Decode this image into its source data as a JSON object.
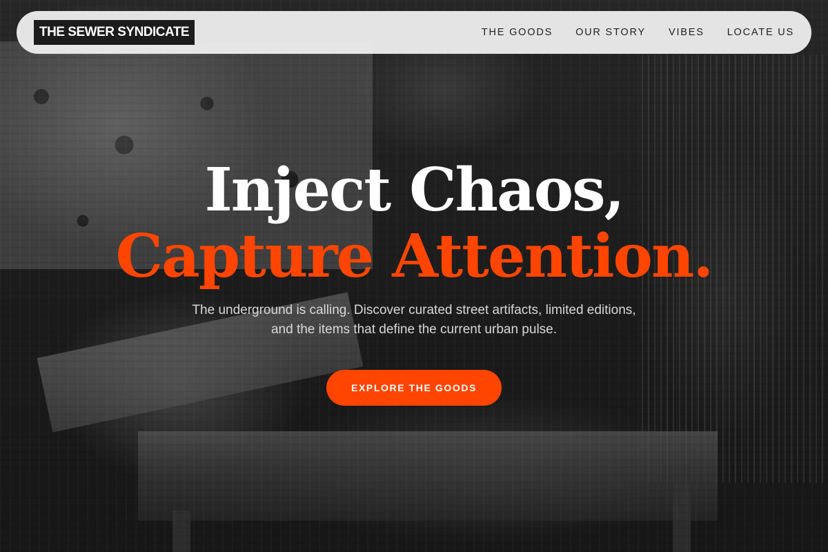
{
  "brand": {
    "logo_text": "THE SEWER SYNDICATE"
  },
  "nav": {
    "items": [
      {
        "label": "THE GOODS"
      },
      {
        "label": "OUR STORY"
      },
      {
        "label": "VIBES"
      },
      {
        "label": "LOCATE US"
      }
    ]
  },
  "hero": {
    "headline_line1": "Inject Chaos,",
    "headline_line2": "Capture Attention.",
    "subtitle": "The underground is calling. Discover curated street artifacts, limited editions, and the items that define the current urban pulse.",
    "cta_label": "EXPLORE THE GOODS",
    "background": "grayscale photo of a market stall with fabrics, beads and souvenirs"
  },
  "colors": {
    "accent": "#ff4500",
    "nav_bg": "#f0f0f0",
    "logo_bg": "#1c1c1c",
    "text_light": "#ffffff"
  }
}
